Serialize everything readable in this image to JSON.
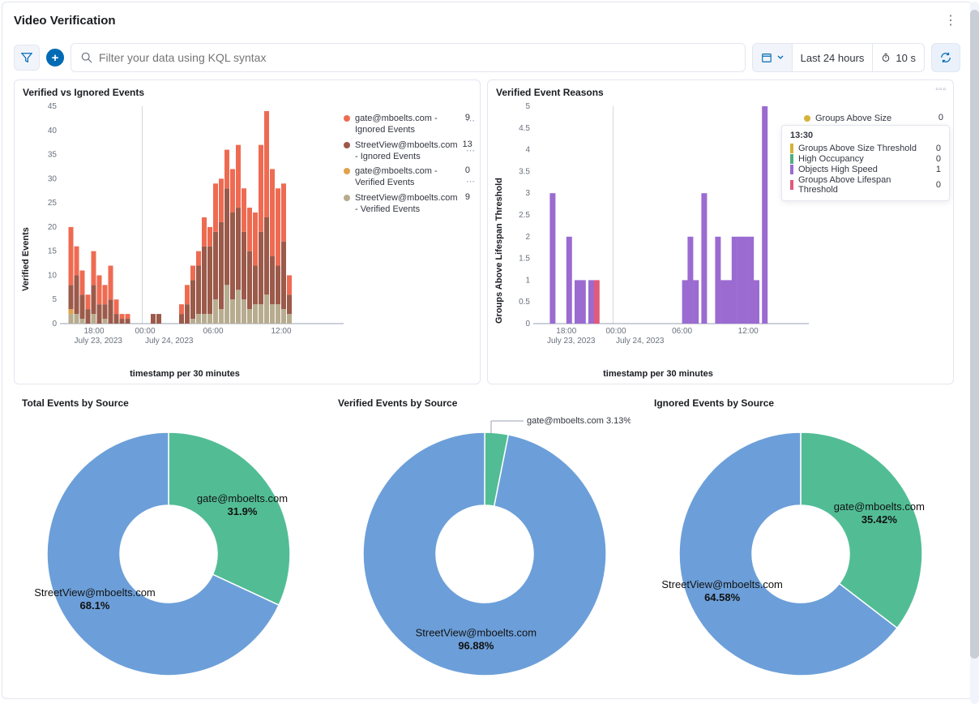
{
  "header": {
    "title": "Video Verification"
  },
  "toolbar": {
    "search_placeholder": "Filter your data using KQL syntax",
    "time_range": "Last 24 hours",
    "refresh_interval": "10 s"
  },
  "panel1": {
    "title": "Verified vs Ignored Events",
    "ylabel": "Verified Events",
    "xaxis_label": "timestamp per 30 minutes",
    "legend": [
      {
        "color": "#ee6b52",
        "label": "gate@mboelts.com - Ignored Events",
        "value": "9"
      },
      {
        "color": "#9b5a4a",
        "label": "StreetView@mboelts.com - Ignored Events",
        "value": "13"
      },
      {
        "color": "#e0a24c",
        "label": "gate@mboelts.com - Verified Events",
        "value": "0"
      },
      {
        "color": "#b7ac8f",
        "label": "StreetView@mboelts.com - Verified Events",
        "value": "9"
      }
    ],
    "chart_data": {
      "type": "bar",
      "ylim": [
        0,
        45
      ],
      "yticks": [
        0,
        5,
        10,
        15,
        20,
        25,
        30,
        35,
        40,
        45
      ],
      "xticks": [
        {
          "pos": 0.12,
          "label": "18:00"
        },
        {
          "pos": 0.3,
          "label": "00:00"
        },
        {
          "pos": 0.54,
          "label": "06:00"
        },
        {
          "pos": 0.78,
          "label": "12:00"
        }
      ],
      "date_labels": [
        {
          "pos": 0.05,
          "label": "July 23, 2023"
        },
        {
          "pos": 0.3,
          "label": "July 24, 2023"
        }
      ],
      "bars": [
        {
          "x": 0.03,
          "stacks": [
            {
              "c": "#b7ac8f",
              "h": 2
            },
            {
              "c": "#e0a24c",
              "h": 1
            },
            {
              "c": "#9b5a4a",
              "h": 5
            },
            {
              "c": "#ee6b52",
              "h": 12
            }
          ]
        },
        {
          "x": 0.05,
          "stacks": [
            {
              "c": "#b7ac8f",
              "h": 2
            },
            {
              "c": "#9b5a4a",
              "h": 8
            },
            {
              "c": "#ee6b52",
              "h": 6
            }
          ]
        },
        {
          "x": 0.07,
          "stacks": [
            {
              "c": "#b7ac8f",
              "h": 1
            },
            {
              "c": "#9b5a4a",
              "h": 5
            },
            {
              "c": "#ee6b52",
              "h": 5
            }
          ]
        },
        {
          "x": 0.09,
          "stacks": [
            {
              "c": "#9b5a4a",
              "h": 3
            },
            {
              "c": "#ee6b52",
              "h": 3
            }
          ]
        },
        {
          "x": 0.11,
          "stacks": [
            {
              "c": "#b7ac8f",
              "h": 2
            },
            {
              "c": "#9b5a4a",
              "h": 6
            },
            {
              "c": "#ee6b52",
              "h": 7
            }
          ]
        },
        {
          "x": 0.13,
          "stacks": [
            {
              "c": "#9b5a4a",
              "h": 4
            },
            {
              "c": "#ee6b52",
              "h": 6
            }
          ]
        },
        {
          "x": 0.15,
          "stacks": [
            {
              "c": "#b7ac8f",
              "h": 1
            },
            {
              "c": "#9b5a4a",
              "h": 3
            },
            {
              "c": "#ee6b52",
              "h": 4
            }
          ]
        },
        {
          "x": 0.17,
          "stacks": [
            {
              "c": "#9b5a4a",
              "h": 5
            },
            {
              "c": "#ee6b52",
              "h": 7
            }
          ]
        },
        {
          "x": 0.19,
          "stacks": [
            {
              "c": "#9b5a4a",
              "h": 2
            },
            {
              "c": "#ee6b52",
              "h": 3
            }
          ]
        },
        {
          "x": 0.21,
          "stacks": [
            {
              "c": "#9b5a4a",
              "h": 1
            },
            {
              "c": "#ee6b52",
              "h": 1
            }
          ]
        },
        {
          "x": 0.23,
          "stacks": [
            {
              "c": "#9b5a4a",
              "h": 1
            },
            {
              "c": "#ee6b52",
              "h": 1
            }
          ]
        },
        {
          "x": 0.32,
          "stacks": [
            {
              "c": "#9b5a4a",
              "h": 2
            }
          ]
        },
        {
          "x": 0.34,
          "stacks": [
            {
              "c": "#9b5a4a",
              "h": 2
            }
          ]
        },
        {
          "x": 0.42,
          "stacks": [
            {
              "c": "#9b5a4a",
              "h": 2
            },
            {
              "c": "#ee6b52",
              "h": 2
            }
          ]
        },
        {
          "x": 0.44,
          "stacks": [
            {
              "c": "#9b5a4a",
              "h": 4
            },
            {
              "c": "#ee6b52",
              "h": 4
            }
          ]
        },
        {
          "x": 0.46,
          "stacks": [
            {
              "c": "#b7ac8f",
              "h": 1
            },
            {
              "c": "#9b5a4a",
              "h": 8
            },
            {
              "c": "#ee6b52",
              "h": 3
            }
          ]
        },
        {
          "x": 0.48,
          "stacks": [
            {
              "c": "#b7ac8f",
              "h": 2
            },
            {
              "c": "#9b5a4a",
              "h": 10
            },
            {
              "c": "#ee6b52",
              "h": 3
            }
          ]
        },
        {
          "x": 0.5,
          "stacks": [
            {
              "c": "#b7ac8f",
              "h": 2
            },
            {
              "c": "#9b5a4a",
              "h": 14
            },
            {
              "c": "#ee6b52",
              "h": 6
            }
          ]
        },
        {
          "x": 0.52,
          "stacks": [
            {
              "c": "#b7ac8f",
              "h": 2
            },
            {
              "c": "#9b5a4a",
              "h": 14
            },
            {
              "c": "#ee6b52",
              "h": 4
            }
          ]
        },
        {
          "x": 0.54,
          "stacks": [
            {
              "c": "#b7ac8f",
              "h": 5
            },
            {
              "c": "#9b5a4a",
              "h": 14
            },
            {
              "c": "#ee6b52",
              "h": 10
            }
          ]
        },
        {
          "x": 0.56,
          "stacks": [
            {
              "c": "#b7ac8f",
              "h": 3
            },
            {
              "c": "#9b5a4a",
              "h": 18
            },
            {
              "c": "#ee6b52",
              "h": 9
            }
          ]
        },
        {
          "x": 0.58,
          "stacks": [
            {
              "c": "#b7ac8f",
              "h": 8
            },
            {
              "c": "#9b5a4a",
              "h": 20
            },
            {
              "c": "#ee6b52",
              "h": 8
            }
          ]
        },
        {
          "x": 0.6,
          "stacks": [
            {
              "c": "#b7ac8f",
              "h": 5
            },
            {
              "c": "#9b5a4a",
              "h": 18
            },
            {
              "c": "#ee6b52",
              "h": 9
            }
          ]
        },
        {
          "x": 0.62,
          "stacks": [
            {
              "c": "#b7ac8f",
              "h": 7
            },
            {
              "c": "#9b5a4a",
              "h": 17
            },
            {
              "c": "#ee6b52",
              "h": 13
            }
          ]
        },
        {
          "x": 0.64,
          "stacks": [
            {
              "c": "#b7ac8f",
              "h": 5
            },
            {
              "c": "#9b5a4a",
              "h": 14
            },
            {
              "c": "#ee6b52",
              "h": 9
            }
          ]
        },
        {
          "x": 0.66,
          "stacks": [
            {
              "c": "#b7ac8f",
              "h": 3
            },
            {
              "c": "#9b5a4a",
              "h": 12
            },
            {
              "c": "#ee6b52",
              "h": 9
            }
          ]
        },
        {
          "x": 0.68,
          "stacks": [
            {
              "c": "#b7ac8f",
              "h": 4
            },
            {
              "c": "#9b5a4a",
              "h": 8
            },
            {
              "c": "#ee6b52",
              "h": 11
            }
          ]
        },
        {
          "x": 0.7,
          "stacks": [
            {
              "c": "#b7ac8f",
              "h": 4
            },
            {
              "c": "#9b5a4a",
              "h": 15
            },
            {
              "c": "#ee6b52",
              "h": 18
            }
          ]
        },
        {
          "x": 0.72,
          "stacks": [
            {
              "c": "#b7ac8f",
              "h": 6
            },
            {
              "c": "#9b5a4a",
              "h": 16
            },
            {
              "c": "#ee6b52",
              "h": 22
            }
          ]
        },
        {
          "x": 0.74,
          "stacks": [
            {
              "c": "#b7ac8f",
              "h": 4
            },
            {
              "c": "#9b5a4a",
              "h": 10
            },
            {
              "c": "#ee6b52",
              "h": 18
            }
          ]
        },
        {
          "x": 0.76,
          "stacks": [
            {
              "c": "#b7ac8f",
              "h": 4
            },
            {
              "c": "#9b5a4a",
              "h": 8
            },
            {
              "c": "#ee6b52",
              "h": 16
            }
          ]
        },
        {
          "x": 0.78,
          "stacks": [
            {
              "c": "#b7ac8f",
              "h": 3
            },
            {
              "c": "#e0a24c",
              "h": 0
            },
            {
              "c": "#9b5a4a",
              "h": 14
            },
            {
              "c": "#ee6b52",
              "h": 12
            }
          ]
        },
        {
          "x": 0.8,
          "stacks": [
            {
              "c": "#b7ac8f",
              "h": 2
            },
            {
              "c": "#9b5a4a",
              "h": 4
            },
            {
              "c": "#ee6b52",
              "h": 4
            }
          ]
        }
      ]
    }
  },
  "panel2": {
    "title": "Verified Event Reasons",
    "ylabel": "Groups Above Lifespan Threshold",
    "xaxis_label": "timestamp per 30 minutes",
    "legend_top": {
      "color": "#d5b23a",
      "label": "Groups Above Size",
      "value": "0"
    },
    "tooltip": {
      "time": "13:30",
      "rows": [
        {
          "c": "#d5b23a",
          "label": "Groups Above Size Threshold",
          "value": "0"
        },
        {
          "c": "#4fae82",
          "label": "High Occupancy",
          "value": "0"
        },
        {
          "c": "#9b6bd1",
          "label": "Objects High Speed",
          "value": "1"
        },
        {
          "c": "#e05a7a",
          "label": "Groups Above Lifespan Threshold",
          "value": "0"
        }
      ]
    },
    "chart_data": {
      "type": "bar",
      "ylim": [
        0,
        5
      ],
      "yticks": [
        0,
        0.5,
        1,
        1.5,
        2,
        2.5,
        3,
        3.5,
        4,
        4.5,
        5
      ],
      "xticks": [
        {
          "pos": 0.12,
          "label": "18:00"
        },
        {
          "pos": 0.3,
          "label": "00:00"
        },
        {
          "pos": 0.54,
          "label": "06:00"
        },
        {
          "pos": 0.78,
          "label": "12:00"
        }
      ],
      "date_labels": [
        {
          "pos": 0.05,
          "label": "July 23, 2023"
        },
        {
          "pos": 0.3,
          "label": "July 24, 2023"
        }
      ],
      "bars": [
        {
          "x": 0.06,
          "h": 3,
          "c": "#9b6bd1"
        },
        {
          "x": 0.12,
          "h": 2,
          "c": "#9b6bd1"
        },
        {
          "x": 0.15,
          "h": 1,
          "c": "#9b6bd1"
        },
        {
          "x": 0.17,
          "h": 1,
          "c": "#9b6bd1"
        },
        {
          "x": 0.2,
          "h": 1,
          "c": "#9b6bd1"
        },
        {
          "x": 0.22,
          "h": 1,
          "c": "#e05a7a"
        },
        {
          "x": 0.54,
          "h": 1,
          "c": "#9b6bd1"
        },
        {
          "x": 0.56,
          "h": 2,
          "c": "#9b6bd1"
        },
        {
          "x": 0.58,
          "h": 1,
          "c": "#9b6bd1"
        },
        {
          "x": 0.61,
          "h": 3,
          "c": "#9b6bd1"
        },
        {
          "x": 0.66,
          "h": 2,
          "c": "#9b6bd1"
        },
        {
          "x": 0.68,
          "h": 1,
          "c": "#9b6bd1"
        },
        {
          "x": 0.7,
          "h": 1,
          "c": "#9b6bd1"
        },
        {
          "x": 0.72,
          "h": 2,
          "c": "#9b6bd1"
        },
        {
          "x": 0.74,
          "h": 2,
          "c": "#9b6bd1"
        },
        {
          "x": 0.76,
          "h": 2,
          "c": "#9b6bd1"
        },
        {
          "x": 0.78,
          "h": 2,
          "c": "#9b6bd1"
        },
        {
          "x": 0.8,
          "h": 1,
          "c": "#9b6bd1"
        },
        {
          "x": 0.83,
          "h": 5,
          "c": "#9b6bd1"
        }
      ]
    }
  },
  "panel3": {
    "title": "Total Events by Source",
    "chart_data": {
      "type": "pie",
      "slices": [
        {
          "label": "gate@mboelts.com",
          "value": 31.9,
          "color": "#52bd95"
        },
        {
          "label": "StreetView@mboelts.com",
          "value": 68.1,
          "color": "#6c9fd9"
        }
      ]
    }
  },
  "panel4": {
    "title": "Verified Events by Source",
    "chart_data": {
      "type": "pie",
      "slices": [
        {
          "label": "gate@mboelts.com",
          "value": 3.13,
          "color": "#52bd95"
        },
        {
          "label": "StreetView@mboelts.com",
          "value": 96.88,
          "color": "#6c9fd9"
        }
      ]
    },
    "callout": "gate@mboelts.com  3.13%"
  },
  "panel5": {
    "title": "Ignored Events by Source",
    "chart_data": {
      "type": "pie",
      "slices": [
        {
          "label": "gate@mboelts.com",
          "value": 35.42,
          "color": "#52bd95"
        },
        {
          "label": "StreetView@mboelts.com",
          "value": 64.58,
          "color": "#6c9fd9"
        }
      ]
    }
  }
}
